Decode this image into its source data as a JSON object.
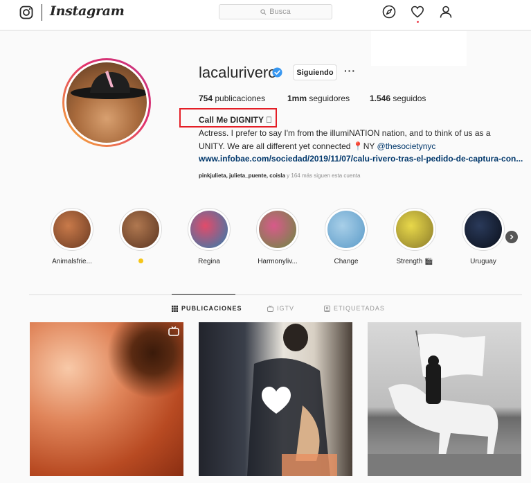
{
  "topbar": {
    "brand": "Instagram",
    "search_placeholder": "Busca",
    "icons": [
      "instagram-glyph-icon",
      "compass-icon",
      "heart-icon",
      "person-icon",
      "search-icon"
    ]
  },
  "profile": {
    "username": "lacalurivero",
    "verified": true,
    "follow_button": "Siguiendo",
    "more": "···",
    "stats": {
      "posts_count": "754",
      "posts_label": "publicaciones",
      "followers_count": "1mm",
      "followers_label": "seguidores",
      "following_count": "1.546",
      "following_label": "seguidos"
    },
    "full_name": "Call Me DIGNITY ⃞",
    "bio_line1": "Actress. I prefer to say I'm from the illumiNATION nation, and to think of us as a",
    "bio_line2_prefix": "UNITY. We are all different yet connected 📍NY ",
    "bio_mention": "@thesocietynyc",
    "link": "www.infobae.com/sociedad/2019/11/07/calu-rivero-tras-el-pedido-de-captura-con...",
    "followed_by_names": "pinkjulieta, julieta_puente, coisla",
    "followed_by_rest": " y 164 más siguen esta cuenta"
  },
  "highlights": [
    {
      "label": "Animalsfrie...",
      "color_a": "#c97a4a",
      "color_b": "#6a3a22"
    },
    {
      "label": "",
      "color_a": "#b07850",
      "color_b": "#5a3420",
      "dot": true
    },
    {
      "label": "Regina",
      "color_a": "#e24b6a",
      "color_b": "#2a7fb0"
    },
    {
      "label": "Harmonyliv...",
      "color_a": "#d85a8a",
      "color_b": "#6a8a40"
    },
    {
      "label": "Change",
      "color_a": "#a8cfe8",
      "color_b": "#5a9ac8"
    },
    {
      "label": "Strength 🎬",
      "color_a": "#e8d84a",
      "color_b": "#8a7a2a"
    },
    {
      "label": "Uruguay",
      "color_a": "#2a3a5a",
      "color_b": "#0a0f1a"
    }
  ],
  "tabs": {
    "posts": "PUBLICACIONES",
    "igtv": "IGTV",
    "tagged": "ETIQUETADAS"
  },
  "colors": {
    "link": "#00376b",
    "highlight_box": "#e41e26",
    "verified": "#3897f0",
    "muted": "#8e8e8e"
  }
}
